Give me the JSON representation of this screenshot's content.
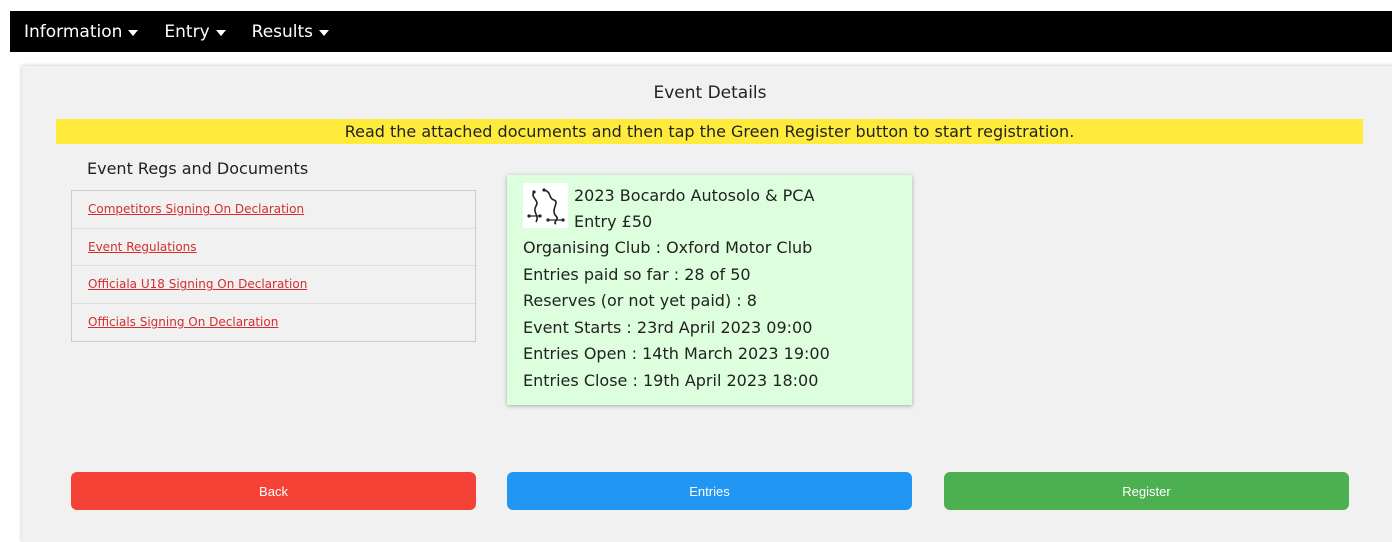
{
  "nav": {
    "items": [
      {
        "label": "Information"
      },
      {
        "label": "Entry"
      },
      {
        "label": "Results"
      }
    ]
  },
  "page": {
    "title": "Event Details",
    "banner": "Read the attached documents and then tap the Green Register button to start registration."
  },
  "documents": {
    "heading": "Event Regs and Documents",
    "items": [
      {
        "label": "Competitors Signing On Declaration"
      },
      {
        "label": "Event Regulations"
      },
      {
        "label": "Officiala U18 Signing On Declaration"
      },
      {
        "label": "Officials Signing On Declaration"
      }
    ]
  },
  "event": {
    "logo_icon": "autosolo-course-logo-icon",
    "name": "2023 Bocardo Autosolo & PCA",
    "entry_fee": "Entry £50",
    "organising_club": "Organising Club : Oxford Motor Club",
    "entries_paid": "Entries paid so far : 28 of 50",
    "reserves": "Reserves (or not yet paid) : 8",
    "starts": "Event Starts : 23rd April 2023  09:00",
    "entries_open": "Entries Open : 14th March 2023  19:00",
    "entries_close": "Entries Close : 19th April 2023  18:00"
  },
  "buttons": {
    "back": "Back",
    "entries": "Entries",
    "register": "Register"
  },
  "colors": {
    "banner": "#ffeb3b",
    "card": "#ddffdd",
    "back": "#f44336",
    "entries": "#2196f3",
    "register": "#4caf50",
    "link": "#d32f2f"
  }
}
